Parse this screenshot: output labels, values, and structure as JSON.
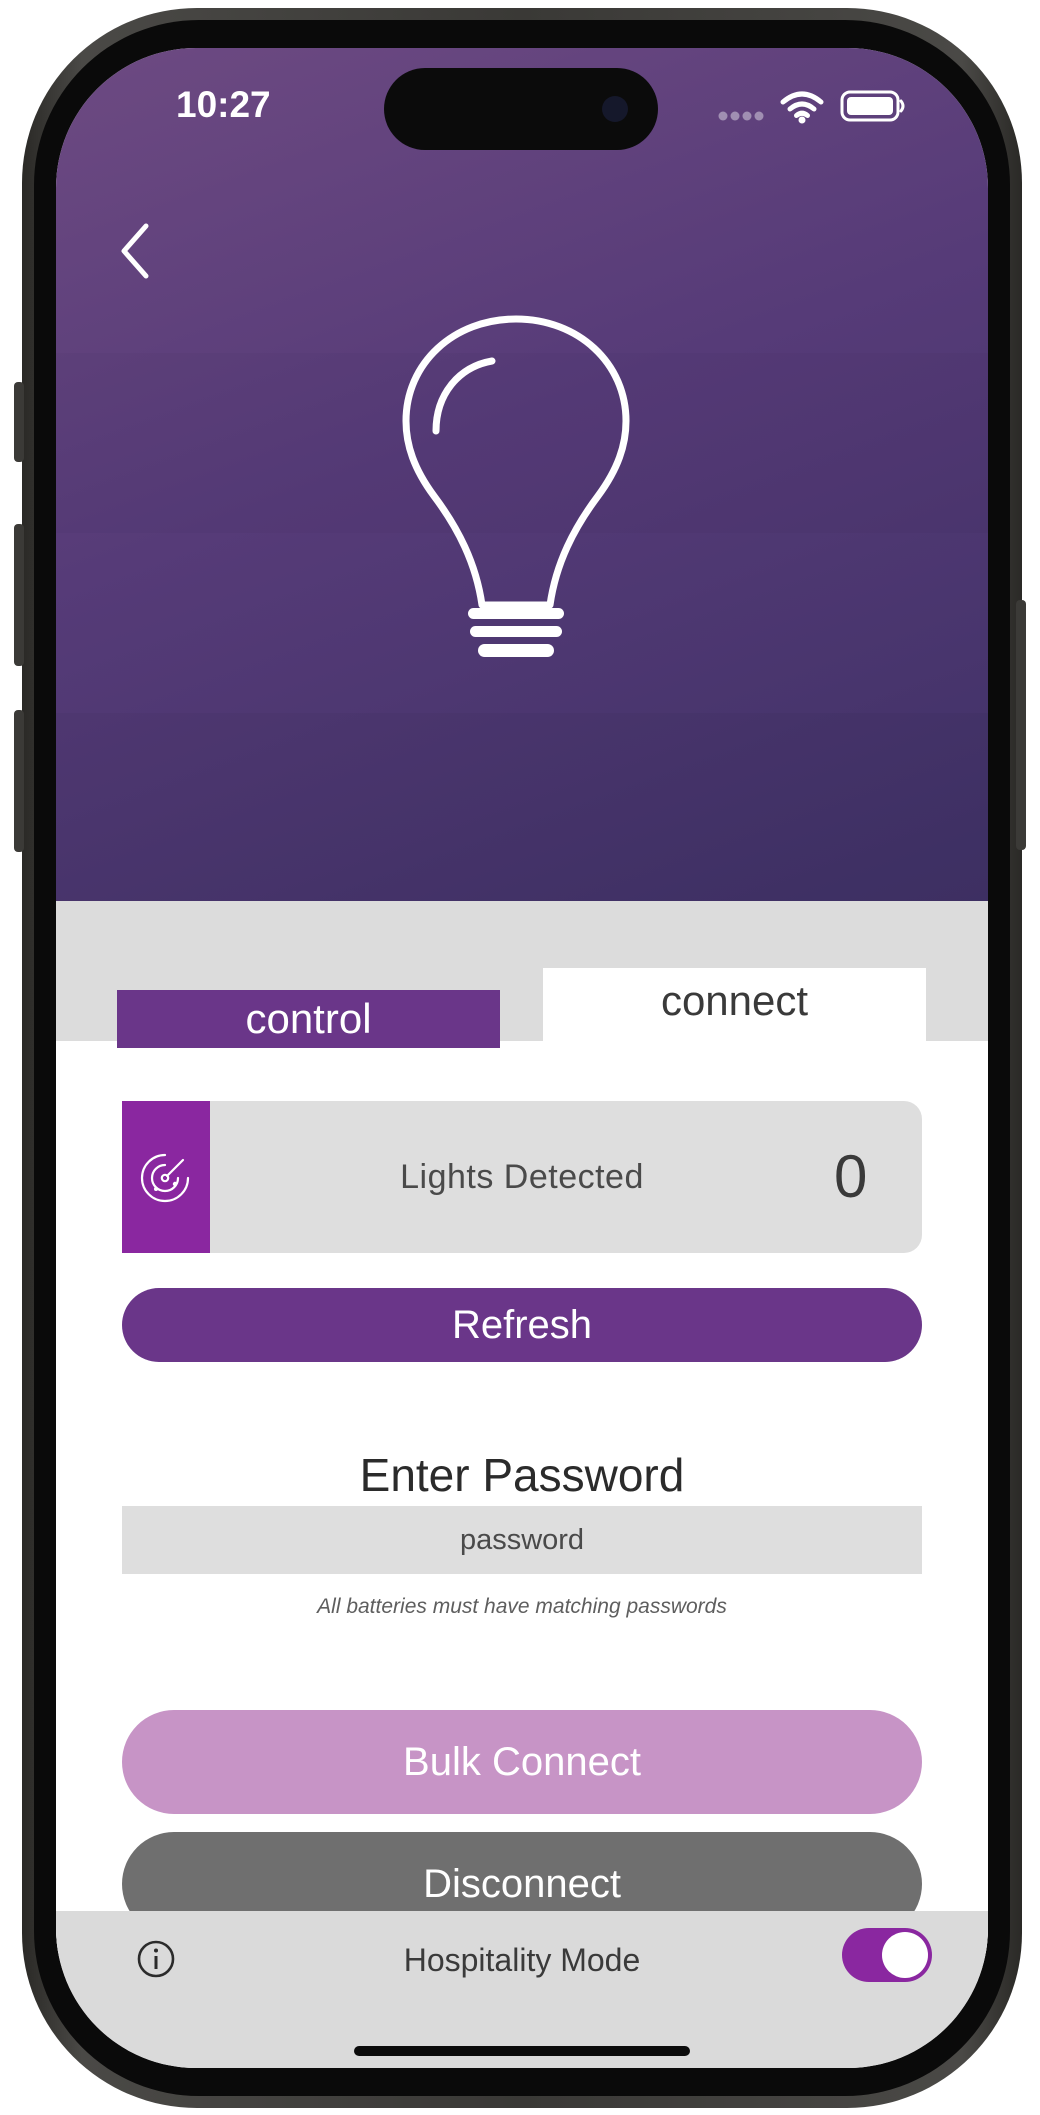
{
  "status_bar": {
    "time": "10:27"
  },
  "tabs": {
    "control": "control",
    "connect": "connect"
  },
  "lights": {
    "label": "Lights Detected",
    "count": "0"
  },
  "buttons": {
    "refresh": "Refresh",
    "bulk_connect": "Bulk Connect",
    "disconnect": "Disconnect"
  },
  "password": {
    "title": "Enter Password",
    "placeholder": "password",
    "value": "",
    "note": "All batteries must have matching passwords"
  },
  "bottom_bar": {
    "label": "Hospitality Mode",
    "toggle_on": true
  },
  "colors": {
    "brand_purple": "#6a3689",
    "accent_magenta": "#8a27a0",
    "bulk_connect_bg": "#c794c6",
    "disconnect_bg": "#6f6f6f"
  },
  "icons": {
    "back": "chevron-left-icon",
    "hero": "lightbulb-icon",
    "lights": "radar-icon",
    "info": "info-icon"
  }
}
